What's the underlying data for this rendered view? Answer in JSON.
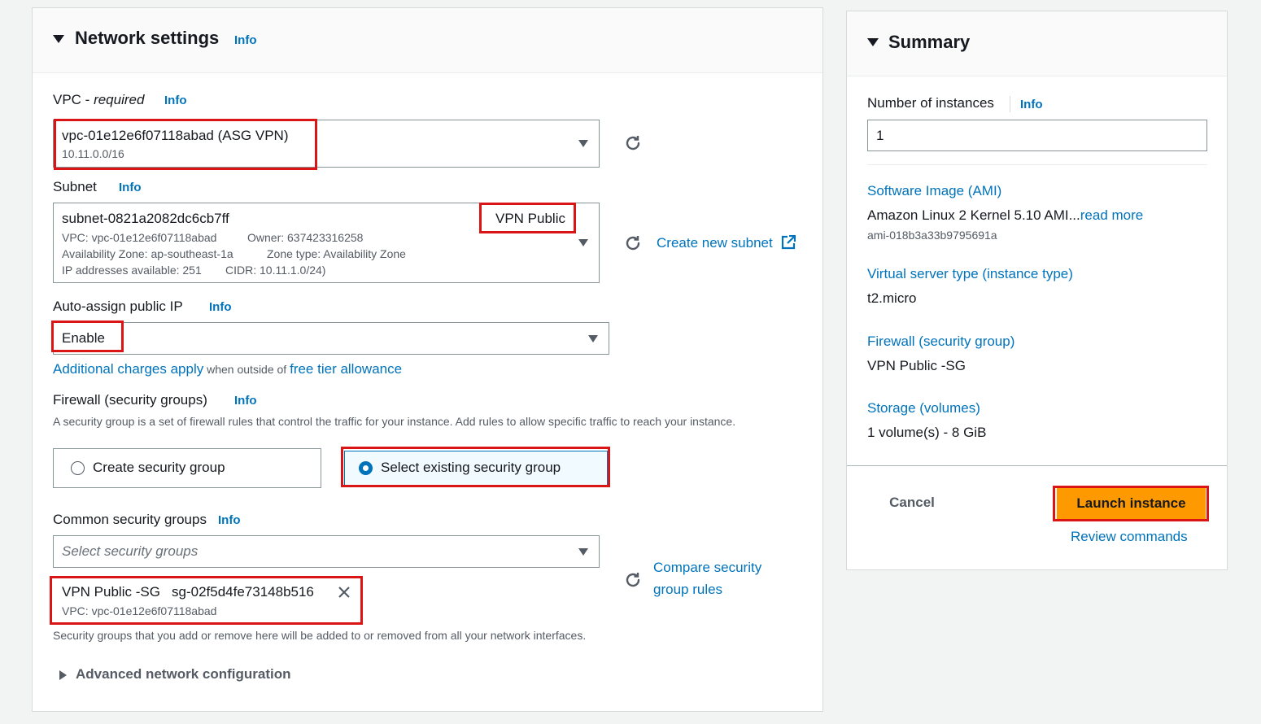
{
  "network": {
    "title": "Network settings",
    "info": "Info",
    "vpc": {
      "label": "VPC - ",
      "label_required": "required",
      "value": "vpc-01e12e6f07118abad (ASG VPN)",
      "cidr": "10.11.0.0/16"
    },
    "subnet": {
      "label": "Subnet",
      "value": "subnet-0821a2082dc6cb7ff",
      "tag": "VPN Public",
      "vpc_line": "VPC: vpc-01e12e6f07118abad",
      "owner_line": "Owner: 637423316258",
      "az_line": "Availability Zone: ap-southeast-1a",
      "zone_type_line": "Zone type: Availability Zone",
      "ip_line": "IP addresses available: 251",
      "cidr_line": "CIDR: 10.11.1.0/24)",
      "create_link": "Create new subnet"
    },
    "auto_ip": {
      "label": "Auto-assign public IP",
      "value": "Enable",
      "charges_link": "Additional charges apply",
      "charges_mid": " when outside of ",
      "free_tier_link": "free tier allowance"
    },
    "firewall": {
      "label": "Firewall (security groups)",
      "description": "A security group is a set of firewall rules that control the traffic for your instance. Add rules to allow specific traffic to reach your instance.",
      "option_create": "Create security group",
      "option_select": "Select existing security group"
    },
    "common_sg": {
      "label": "Common security groups",
      "placeholder": "Select security groups",
      "compare_link_1": "Compare security",
      "compare_link_2": "group rules",
      "token_name": "VPN Public -SG",
      "token_id": "sg-02f5d4fe73148b516",
      "token_vpc": "VPC: vpc-01e12e6f07118abad",
      "help": "Security groups that you add or remove here will be added to or removed from all your network interfaces."
    },
    "advanced": "Advanced network configuration"
  },
  "summary": {
    "title": "Summary",
    "instances_label": "Number of instances",
    "info": "Info",
    "instances_value": "1",
    "ami_link": "Software Image (AMI)",
    "ami_value": "Amazon Linux 2 Kernel 5.10 AMI...",
    "ami_read_more": "read more",
    "ami_id": "ami-018b3a33b9795691a",
    "type_link": "Virtual server type (instance type)",
    "type_value": "t2.micro",
    "firewall_link": "Firewall (security group)",
    "firewall_value": "VPN Public -SG",
    "storage_link": "Storage (volumes)",
    "storage_value": "1 volume(s) - 8 GiB",
    "cancel": "Cancel",
    "launch": "Launch instance",
    "review": "Review commands"
  },
  "colors": {
    "accent_link": "#0073bb",
    "launch_button": "#ff9900",
    "highlight_box": "#d91515",
    "radio_selected": "#0073bb"
  },
  "icons": [
    "caret-down-icon",
    "refresh-icon",
    "external-link-icon",
    "close-icon",
    "radio-icon",
    "expand-triangle-icon"
  ]
}
